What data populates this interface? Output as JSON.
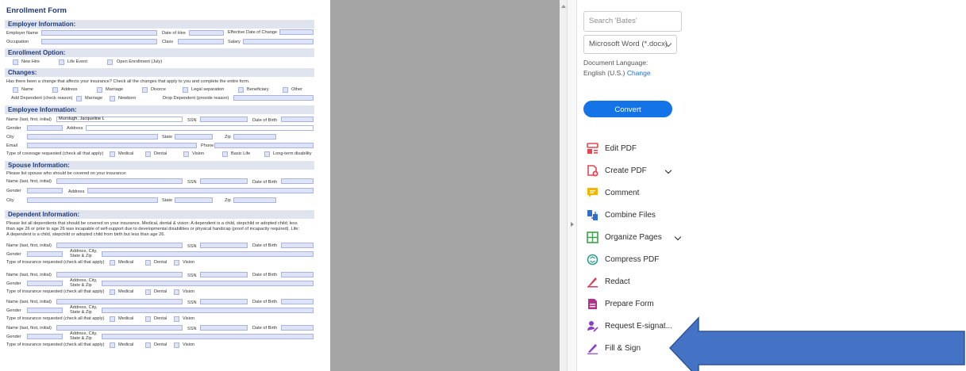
{
  "form": {
    "title": "Enrollment Form",
    "sections": {
      "employer": "Employer Information:",
      "enrollment": "Enrollment Option:",
      "changes": "Changes:",
      "employee": "Employee Information:",
      "spouse": "Spouse Information:",
      "dependent": "Dependent Information:"
    },
    "employer": {
      "employer_name": "Employer Name",
      "date_of_hire": "Date of Hire",
      "effective_date": "Effective Date of Change",
      "occupation": "Occupation",
      "class": "Class",
      "salary": "Salary"
    },
    "enrollment_options": [
      "New Hire",
      "Life Event",
      "Open Enrollment (July)"
    ],
    "changes": {
      "prompt": "Has there been a change that affects your insurance? Check all the changes that apply to you and complete the entire form.",
      "options_row1": [
        "Name",
        "Address",
        "Marriage",
        "Divorce",
        "Legal separation",
        "Beneficiary",
        "Other"
      ],
      "add_dependent": "Add Dependent (check reason)",
      "add_dep_options": [
        "Marriage",
        "Newborn"
      ],
      "drop_dependent": "Drop Dependent (provide reason)"
    },
    "employee": {
      "name_label": "Name (last, first, initial)",
      "name_value": "Murolugh, Jacqueline L",
      "ssn": "SSN",
      "dob": "Date of Birth",
      "gender": "Gender",
      "address": "Address",
      "city": "City",
      "state": "State",
      "zip": "Zip",
      "email": "Email",
      "phone": "Phone",
      "coverage_label": "Type of coverage requested (check all that apply)",
      "coverage_options": [
        "Medical",
        "Dental",
        "Vision",
        "Basic Life",
        "Long-term disability"
      ]
    },
    "spouse": {
      "prompt": "Please list spouse who should be covered on your insurance:",
      "name_label": "Name (last, first, initial)",
      "ssn": "SSN",
      "dob": "Date of Birth",
      "gender": "Gender",
      "address": "Address",
      "city": "City",
      "state": "State",
      "zip": "Zip"
    },
    "dependent": {
      "prompt_line1": "Please list all dependents that should be covered on your insurance. Medical, dental & vision: A dependent is a child, stepchild or adopted child; less",
      "prompt_line2": "than age 26 or prior to age 26 was incapable of self-support due to developmental disabilities or physical handicap (proof of incapacity required). Life:",
      "prompt_line3": "A dependent is a child, stepchild or adopted child from birth but less than age 26.",
      "name_label": "Name (last, first, initial)",
      "ssn": "SSN",
      "dob": "Date of Birth",
      "gender": "Gender",
      "address_label": "Address, City,",
      "address_label2": "State & Zip",
      "insurance_label": "Type of insurance requested (check all that apply)",
      "insurance_options": [
        "Medical",
        "Dental",
        "Vision"
      ]
    }
  },
  "pane": {
    "search_placeholder": "Search 'Bates'",
    "format_select": "Microsoft Word (*.docx)",
    "doc_language_label": "Document Language:",
    "doc_language_value": "English (U.S.)",
    "change_link": "Change",
    "convert": "Convert",
    "tools": [
      {
        "label": "Edit PDF",
        "icon": "edit-pdf-icon"
      },
      {
        "label": "Create PDF",
        "icon": "create-pdf-icon"
      },
      {
        "label": "Comment",
        "icon": "comment-icon"
      },
      {
        "label": "Combine Files",
        "icon": "combine-files-icon"
      },
      {
        "label": "Organize Pages",
        "icon": "organize-pages-icon"
      },
      {
        "label": "Compress PDF",
        "icon": "compress-pdf-icon"
      },
      {
        "label": "Redact",
        "icon": "redact-icon"
      },
      {
        "label": "Prepare Form",
        "icon": "prepare-form-icon"
      },
      {
        "label": "Request E-signat...",
        "icon": "request-esign-icon"
      },
      {
        "label": "Fill & Sign",
        "icon": "fill-sign-icon"
      }
    ]
  },
  "colors": {
    "accent": "#1473e6",
    "arrow": "#4472c4",
    "section_bg": "#dfe4ee",
    "field_bg": "#dfe3f7"
  }
}
